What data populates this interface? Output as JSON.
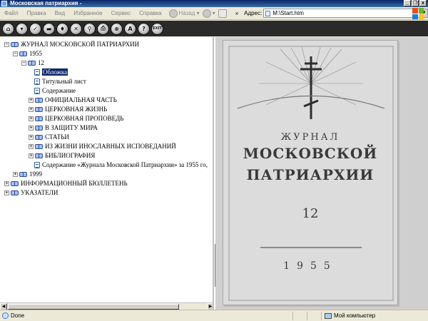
{
  "window": {
    "title": "Московская патриархия -"
  },
  "menu": [
    "Файл",
    "Правка",
    "Вид",
    "Избранное",
    "Сервис",
    "Справка"
  ],
  "nav": {
    "back_label": "Назад"
  },
  "address": {
    "label": "Адрес:",
    "value": "M:\\Start.htm"
  },
  "toolbar": {
    "exit_label": "EXIT"
  },
  "tree": {
    "root": "ЖУРНАЛ МОСКОВСКОЙ ПАТРИАРХИИ",
    "year1955": "1955",
    "issue12": "12",
    "cover": "Обложка",
    "title_page": "Титульный лист",
    "contents": "Содержание",
    "official": "ОФИЦИАЛЬНАЯ ЧАСТЬ",
    "church_life": "ЦЕРКОВНАЯ ЖИЗНЬ",
    "sermon": "ЦЕРКОВНАЯ ПРОПОВЕДЬ",
    "peace": "В ЗАЩИТУ МИРА",
    "articles": "СТАТЬИ",
    "heterodox": "ИЗ ЖИЗНИ ИНОСЛАВНЫХ ИСПОВЕДАНИЙ",
    "bibliography": "БИБЛИОГРАФИЯ",
    "annual_contents": "Содержание «Журнала Московской Патриархии» за 1955 го,",
    "year1999": "1999",
    "bulletin": "ИНФОРМАЦИОННЫЙ БЮЛЛЕТЕНЬ",
    "indexes": "УКАЗАТЕЛИ"
  },
  "cover": {
    "line1": "ЖУРНАЛ",
    "line2": "МОСКОВСКОЙ",
    "line3": "ПАТРИАРХИИ",
    "number": "12",
    "year": "1955"
  },
  "status": {
    "text": "Done",
    "zone": "Мой компьютер"
  },
  "colors": {
    "title_bar": "#0a246a",
    "toolbar_bg": "#2a2a2a",
    "selection": "#0a246a"
  }
}
